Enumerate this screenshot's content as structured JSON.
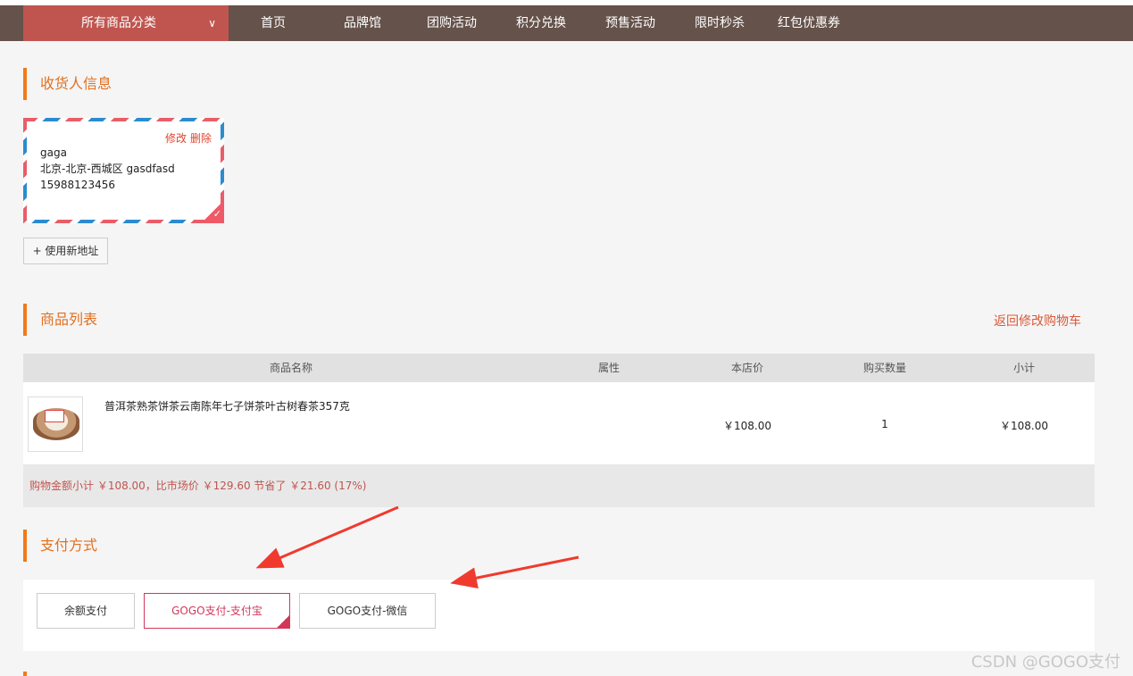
{
  "nav": {
    "category_label": "所有商品分类",
    "items": [
      "首页",
      "品牌馆",
      "团购活动",
      "积分兑换",
      "预售活动",
      "限时秒杀",
      "红包优惠券"
    ]
  },
  "receiver": {
    "title": "收货人信息",
    "card": {
      "edit": "修改",
      "delete": "删除",
      "name": "gaga",
      "address": "北京-北京-西城区 gasdfasd",
      "phone": "15988123456"
    },
    "new_address_button": "+ 使用新地址"
  },
  "products": {
    "title": "商品列表",
    "back_link": "返回修改购物车",
    "columns": [
      "商品名称",
      "属性",
      "本店价",
      "购买数量",
      "小计"
    ],
    "rows": [
      {
        "name": "普洱茶熟茶饼茶云南陈年七子饼茶叶古树春茶357克",
        "attr": "",
        "price": "￥108.00",
        "qty": "1",
        "subtotal": "￥108.00"
      }
    ],
    "summary": "购物金额小计 ￥108.00，比市场价 ￥129.60 节省了 ￥21.60 (17%)"
  },
  "payment": {
    "title": "支付方式",
    "options": [
      "余额支付",
      "GOGO支付-支付宝",
      "GOGO支付-微信"
    ],
    "selected_index": 1
  },
  "watermark": "CSDN @GOGO支付",
  "colors": {
    "nav_bg": "#65524a",
    "category_bg": "#c0554f",
    "section_accent": "#f07a18",
    "selected_payment": "#d2375a",
    "annotation_arrow": "#f03a2e"
  }
}
